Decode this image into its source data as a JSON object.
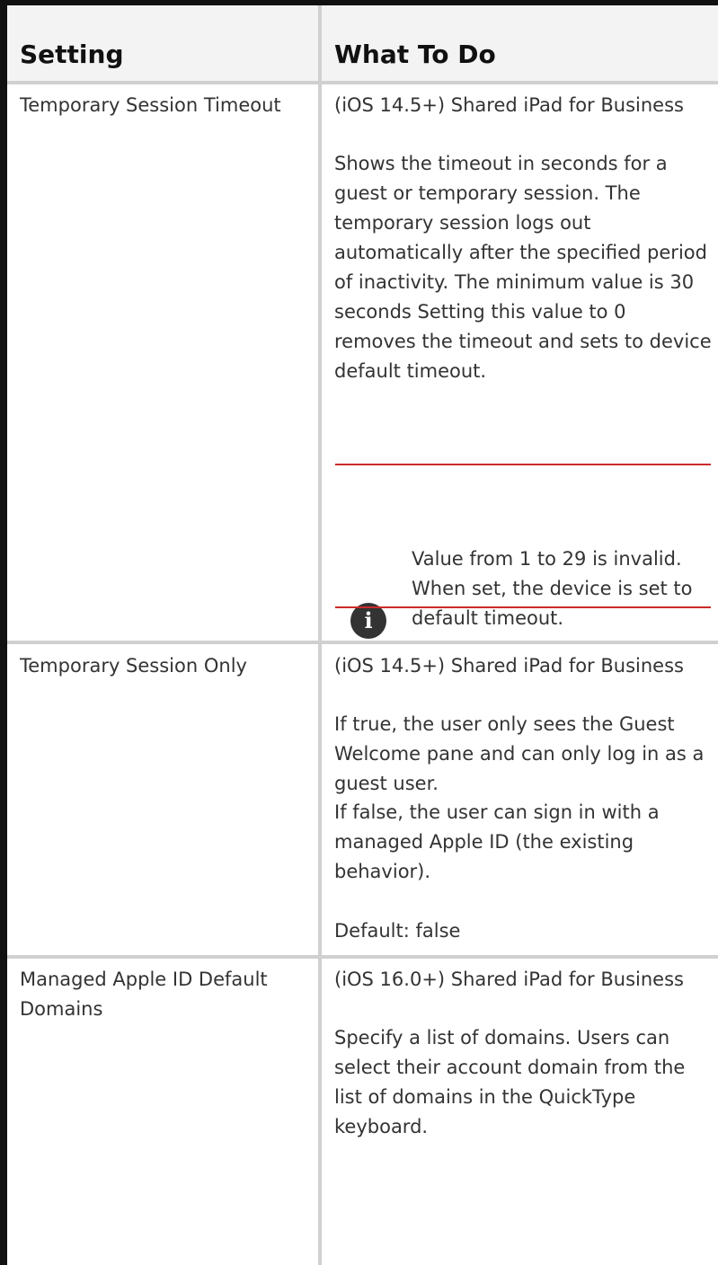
{
  "table": {
    "headers": {
      "setting": "Setting",
      "what_to_do": "What To Do"
    },
    "rows": [
      {
        "setting": "Temporary Session Timeout",
        "version": "(iOS 14.5+) Shared iPad for Business",
        "description": "Shows the timeout in seconds for a guest or temporary session. The temporary session logs out automatically after the specified period of inactivity. The minimum value is 30 seconds Setting this value to 0 removes the timeout and sets to device default timeout.",
        "note": "Value from 1 to 29 is invalid. When set, the device is set to default timeout."
      },
      {
        "setting": "Temporary Session Only",
        "version": "(iOS 14.5+) Shared iPad for Business",
        "paragraphs": [
          "If true, the user only sees the Guest Welcome pane and can only log in as a guest user.",
          "If false, the user can sign in with a managed Apple ID (the existing behavior).",
          "Default: false"
        ]
      },
      {
        "setting": "Managed Apple ID Default Domains",
        "version": "(iOS 16.0+) Shared iPad for Business",
        "description": "Specify a list of domains. Users can select their account domain from the list of domains in the QuickType keyboard."
      }
    ]
  },
  "icons": {
    "note_icon": "info-icon",
    "note_icon_glyph": "i"
  },
  "colors": {
    "note_rule": "#cc2a2a",
    "header_bg": "#f3f3f3",
    "border": "#d0d0d0"
  }
}
